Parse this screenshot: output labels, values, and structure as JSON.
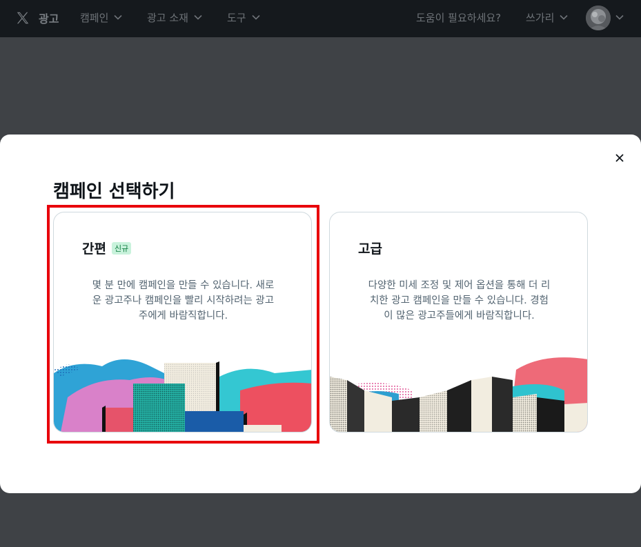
{
  "nav": {
    "brand": "광고",
    "items": [
      "캠페인",
      "광고 소재",
      "도구"
    ],
    "help": "도움이 필요하세요?",
    "account": "쓰가리"
  },
  "modal": {
    "title": "캠페인 선택하기",
    "cards": [
      {
        "title": "간편",
        "badge": "신규",
        "desc_lines": [
          "몇 분 만에 캠페인을 만들 수 있습니다. 새로",
          "운 광고주나 캠페인을 빨리 시작하려는 광고",
          "주에게 바람직합니다."
        ]
      },
      {
        "title": "고급",
        "desc_lines": [
          "다양한 미세 조정 및 제어 옵션을 통해 더 리",
          "치한 광고 캠페인을 만들 수 있습니다. 경험",
          "이 많은 광고주들에게 바람직합니다."
        ]
      }
    ]
  },
  "colors": {
    "nav_bg": "#15191d",
    "overlay": "#3f4246",
    "highlight": "#e8000b",
    "badge_bg": "#c9f2dc",
    "badge_text": "#0a7a3c"
  },
  "icons": {
    "logo": "x-logo-icon",
    "dropdown": "chevron-down-icon",
    "close": "close-icon"
  }
}
